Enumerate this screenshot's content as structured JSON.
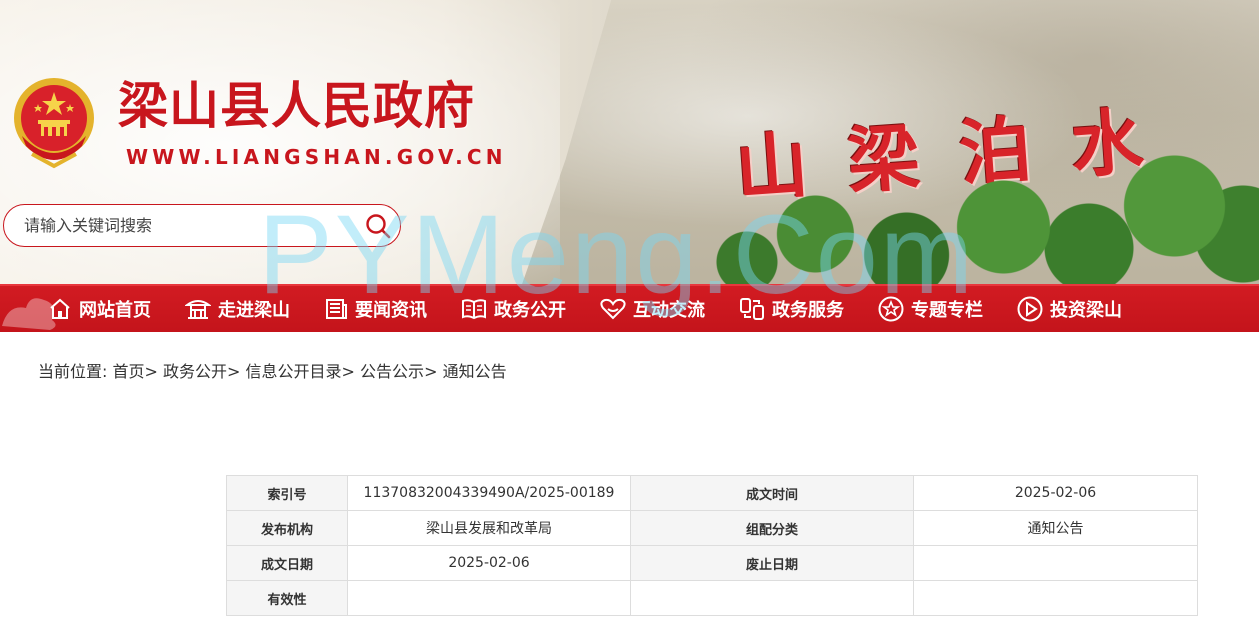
{
  "header": {
    "title": "梁山县人民政府",
    "url": "WWW.LIANGSHAN.GOV.CN",
    "banner_text": "山梁泊水"
  },
  "search": {
    "placeholder": "请输入关键词搜索"
  },
  "nav": {
    "items": [
      {
        "label": "网站首页",
        "icon": "home-icon"
      },
      {
        "label": "走进梁山",
        "icon": "pavilion-icon"
      },
      {
        "label": "要闻资讯",
        "icon": "news-icon"
      },
      {
        "label": "政务公开",
        "icon": "book-icon"
      },
      {
        "label": "互动交流",
        "icon": "heart-icon"
      },
      {
        "label": "政务服务",
        "icon": "service-icon"
      },
      {
        "label": "专题专栏",
        "icon": "star-icon"
      },
      {
        "label": "投资梁山",
        "icon": "play-icon"
      }
    ]
  },
  "breadcrumb": {
    "prefix": "当前位置:",
    "items": [
      "首页",
      "政务公开",
      "信息公开目录",
      "公告公示",
      "通知公告"
    ],
    "separator": ">"
  },
  "meta_table": {
    "rows": [
      {
        "k1": "索引号",
        "v1": "11370832004339490A/2025-00189",
        "k2": "成文时间",
        "v2": "2025-02-06"
      },
      {
        "k1": "发布机构",
        "v1": "梁山县发展和改革局",
        "k2": "组配分类",
        "v2": "通知公告"
      },
      {
        "k1": "成文日期",
        "v1": "2025-02-06",
        "k2": "废止日期",
        "v2": ""
      },
      {
        "k1": "有效性",
        "v1": "",
        "k2": "",
        "v2": ""
      }
    ]
  },
  "watermark": "PYMeng.Com",
  "colors": {
    "brand_red": "#c8161d",
    "nav_red": "#d21b22",
    "table_label_bg": "#f5f5f5"
  }
}
